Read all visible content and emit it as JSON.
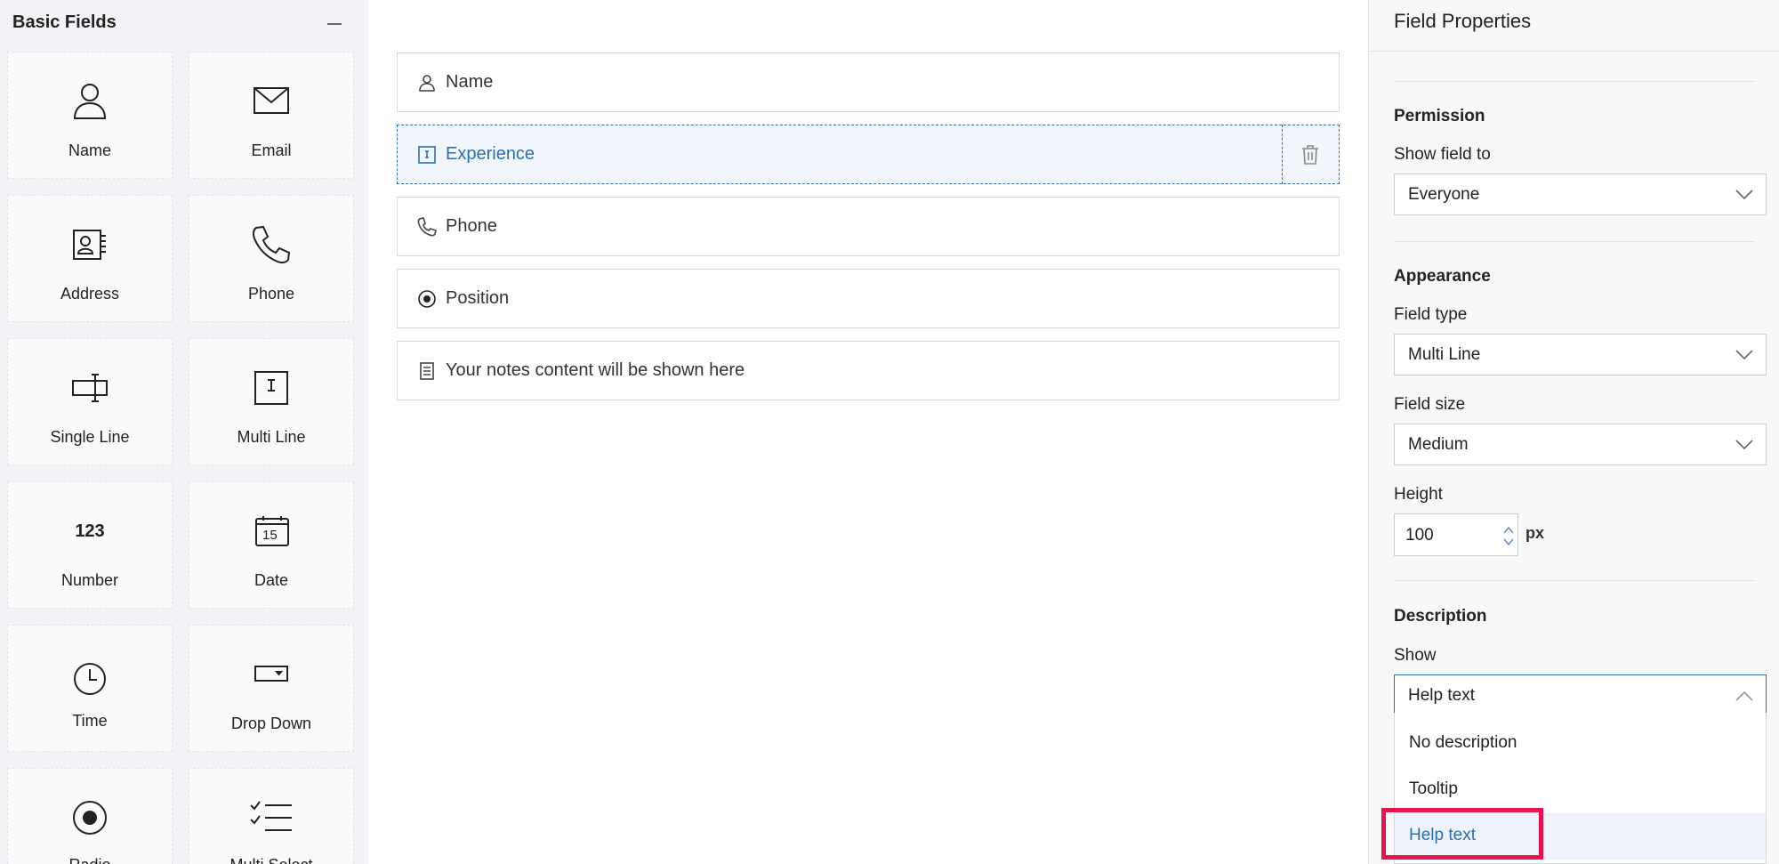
{
  "palette": {
    "title": "Basic Fields",
    "tiles": [
      {
        "label": "Name",
        "icon": "person-icon"
      },
      {
        "label": "Email",
        "icon": "envelope-icon"
      },
      {
        "label": "Address",
        "icon": "address-card-icon"
      },
      {
        "label": "Phone",
        "icon": "phone-icon"
      },
      {
        "label": "Single Line",
        "icon": "single-line-icon"
      },
      {
        "label": "Multi Line",
        "icon": "multi-line-icon"
      },
      {
        "label": "Number",
        "icon": "number-icon",
        "glyph": "123"
      },
      {
        "label": "Date",
        "icon": "calendar-icon",
        "glyph": "15"
      },
      {
        "label": "Time",
        "icon": "clock-icon"
      },
      {
        "label": "Drop Down",
        "icon": "dropdown-icon"
      },
      {
        "label": "Radio",
        "icon": "radio-icon"
      },
      {
        "label": "Multi Select",
        "icon": "checklist-icon"
      }
    ]
  },
  "canvas": {
    "fields": [
      {
        "label": "Name",
        "icon": "person-icon"
      },
      {
        "label": "Experience",
        "icon": "multi-line-icon",
        "selected": true
      },
      {
        "label": "Phone",
        "icon": "phone-icon"
      },
      {
        "label": "Position",
        "icon": "radio-icon"
      },
      {
        "label": "Your notes content will be shown here",
        "icon": "notes-icon"
      }
    ],
    "delete_icon": "trash-icon"
  },
  "properties": {
    "title": "Field Properties",
    "permission": {
      "heading": "Permission",
      "show_field_to_label": "Show field to",
      "show_field_to_value": "Everyone"
    },
    "appearance": {
      "heading": "Appearance",
      "field_type_label": "Field type",
      "field_type_value": "Multi Line",
      "field_size_label": "Field size",
      "field_size_value": "Medium",
      "height_label": "Height",
      "height_value": "100",
      "height_unit": "px"
    },
    "description": {
      "heading": "Description",
      "show_label": "Show",
      "show_value": "Help text",
      "options": [
        "No description",
        "Tooltip",
        "Help text"
      ],
      "active_option": "Help text"
    }
  },
  "colors": {
    "accent": "#2e6fb0",
    "highlight": "#e8134e",
    "panel_bg": "#f2f3f6"
  }
}
